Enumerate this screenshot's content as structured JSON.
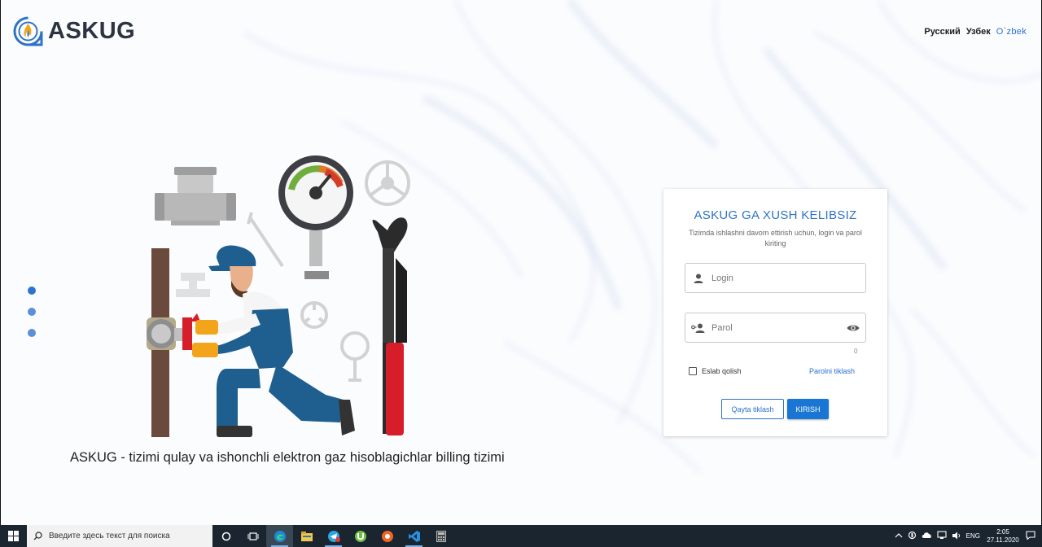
{
  "brand": {
    "name": "ASKUG"
  },
  "languages": [
    {
      "label": "Русский",
      "active": false
    },
    {
      "label": "Узбек",
      "active": false
    },
    {
      "label": "O`zbek",
      "active": true
    }
  ],
  "carousel": {
    "slides": 3,
    "active_index": 0
  },
  "tagline": "ASKUG - tizimi qulay va ishonchli elektron gaz hisoblagichlar billing tizimi",
  "login_form": {
    "title": "ASKUG GA XUSH KELIBSIZ",
    "subtitle": "Tizimda ishlashni davom ettirish uchun, login va parol kiriting",
    "login_placeholder": "Login",
    "password_placeholder": "Parol",
    "password_counter": "0",
    "remember_label": "Eslab qolish",
    "forgot_label": "Parolni tiklash",
    "reset_button": "Qayta tiklash",
    "submit_button": "KIRISH"
  },
  "taskbar": {
    "search_placeholder": "Введите здесь текст для поиска",
    "apps": [
      "cortana-icon",
      "task-view-icon",
      "edge-icon",
      "file-explorer-icon",
      "telegram-icon",
      "utorrent-icon",
      "chromium-icon",
      "vscode-icon",
      "calculator-icon"
    ],
    "language": "ENG",
    "time": "2:05",
    "date": "27.11.2020"
  },
  "colors": {
    "accent": "#1976d2",
    "title": "#2f73c5",
    "taskbar": "#1a2530"
  }
}
